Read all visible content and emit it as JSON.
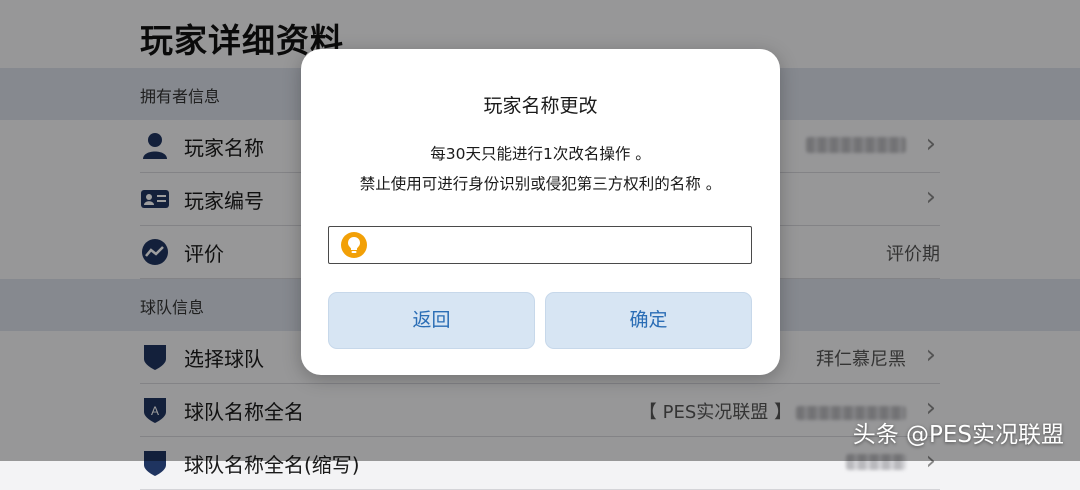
{
  "page": {
    "title": "玩家详细资料",
    "sections": [
      {
        "header": "拥有者信息",
        "rows": [
          {
            "label": "玩家名称",
            "value": "",
            "icon": "person-icon"
          },
          {
            "label": "玩家编号",
            "value": "",
            "icon": "id-card-icon"
          },
          {
            "label": "评价",
            "value": "评价期",
            "icon": "rating-icon"
          }
        ]
      },
      {
        "header": "球队信息",
        "rows": [
          {
            "label": "选择球队",
            "value": "拜仁慕尼黑",
            "icon": "shield-icon"
          },
          {
            "label": "球队名称全名",
            "value": "【 PES实况联盟 】",
            "icon": "shield-a-icon"
          },
          {
            "label": "球队名称全名(缩写)",
            "value": "",
            "icon": "shield-icon"
          }
        ]
      }
    ]
  },
  "dialog": {
    "title": "玩家名称更改",
    "message_line1": "每30天只能进行1次改名操作 。",
    "message_line2": "禁止使用可进行身份识别或侵犯第三方权利的名称 。",
    "input_value": "",
    "back_label": "返回",
    "confirm_label": "确定"
  },
  "watermark": "头条 @PES实况联盟",
  "colors": {
    "accent": "#2a6db5",
    "button_bg": "#d7e5f3",
    "icon_navy": "#1f3460",
    "bulb": "#f2a007"
  }
}
